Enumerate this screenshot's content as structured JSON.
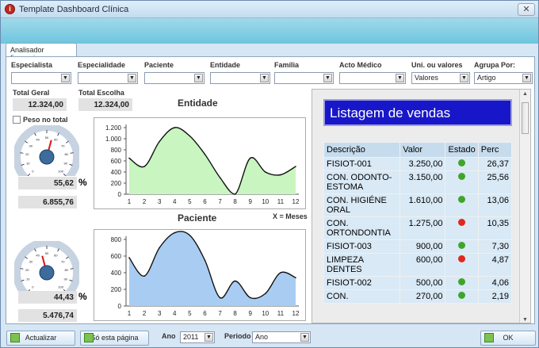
{
  "window": {
    "title": "Template Dashboard Clínica",
    "close": "✕"
  },
  "tabs": {
    "active": "Analisador financeiro"
  },
  "filters": {
    "especialista": {
      "label": "Especialista",
      "value": ""
    },
    "especialidade": {
      "label": "Especialidade",
      "value": ""
    },
    "paciente": {
      "label": "Paciente",
      "value": ""
    },
    "entidade": {
      "label": "Entidade",
      "value": ""
    },
    "familia": {
      "label": "Família",
      "value": ""
    },
    "acto": {
      "label": "Acto Médico",
      "value": ""
    },
    "uni": {
      "label": "Uni. ou valores",
      "value": "Valores"
    },
    "agrupa": {
      "label": "Agrupa Por:",
      "value": "Artigo"
    }
  },
  "totals": {
    "geral_label": "Total Geral",
    "geral_value": "12.324,00",
    "escolha_label": "Total Escolha",
    "escolha_value": "12.324,00",
    "peso_label": "Peso no total"
  },
  "gauge1": {
    "percent": "55,62",
    "unit": "%",
    "value": "6.855,76",
    "fraction": 0.5562,
    "ticks": [
      "0",
      "10",
      "20",
      "30",
      "40",
      "50",
      "60",
      "70",
      "80",
      "90",
      "100"
    ]
  },
  "gauge2": {
    "percent": "44,43",
    "unit": "%",
    "value": "5.476,74",
    "fraction": 0.4443,
    "ticks": [
      "0",
      "10",
      "20",
      "30",
      "40",
      "50",
      "60",
      "70",
      "80",
      "90",
      "100"
    ]
  },
  "chart_data": [
    {
      "type": "area",
      "title": "Entidade",
      "x": [
        1,
        2,
        3,
        4,
        5,
        6,
        7,
        8,
        9,
        10,
        11,
        12
      ],
      "values": [
        650,
        500,
        950,
        1200,
        1050,
        720,
        300,
        0,
        650,
        400,
        350,
        500
      ],
      "ylim": [
        0,
        1200
      ],
      "yticks": [
        "1.200",
        "1.000",
        "800",
        "600",
        "400",
        "200",
        "0"
      ],
      "fill": "#c8f5c0",
      "stroke": "#111111"
    },
    {
      "type": "area",
      "title": "Paciente",
      "xnote": "X = Meses",
      "x": [
        1,
        2,
        3,
        4,
        5,
        6,
        7,
        8,
        9,
        10,
        11,
        12
      ],
      "values": [
        580,
        360,
        700,
        880,
        850,
        550,
        100,
        300,
        100,
        150,
        400,
        340
      ],
      "ylim": [
        0,
        800
      ],
      "yticks": [
        "800",
        "600",
        "400",
        "200",
        "0"
      ],
      "fill": "#a9cdf2",
      "stroke": "#111111"
    }
  ],
  "listing": {
    "title": "Listagem de vendas",
    "columns": [
      "Descrição",
      "Valor",
      "Estado",
      "Perc"
    ],
    "rows": [
      {
        "desc": "FISIOT-001",
        "valor": "3.250,00",
        "estado": "green",
        "perc": "26,37"
      },
      {
        "desc": "CON. ODONTO-ESTOMA",
        "valor": "3.150,00",
        "estado": "green",
        "perc": "25,56"
      },
      {
        "desc": "CON. HIGIÉNE ORAL",
        "valor": "1.610,00",
        "estado": "green",
        "perc": "13,06"
      },
      {
        "desc": "CON. ORTONDONTIA",
        "valor": "1.275,00",
        "estado": "red",
        "perc": "10,35"
      },
      {
        "desc": "FISIOT-003",
        "valor": "900,00",
        "estado": "green",
        "perc": "7,30"
      },
      {
        "desc": "LIMPEZA DENTES",
        "valor": "600,00",
        "estado": "red",
        "perc": "4,87"
      },
      {
        "desc": "FISIOT-002",
        "valor": "500,00",
        "estado": "green",
        "perc": "4,06"
      },
      {
        "desc": "CON.",
        "valor": "270,00",
        "estado": "green",
        "perc": "2,19"
      }
    ]
  },
  "bottom": {
    "actualizar": "Actualizar",
    "so_pagina": "Só esta página",
    "ano_label": "Ano",
    "ano_value": "2011",
    "periodo_label": "Periodo",
    "periodo_value": "Ano",
    "ok": "OK"
  },
  "colors": {
    "green_dot": "#3fa52a",
    "red_dot": "#e0281e",
    "header_blue": "#1717c9"
  }
}
